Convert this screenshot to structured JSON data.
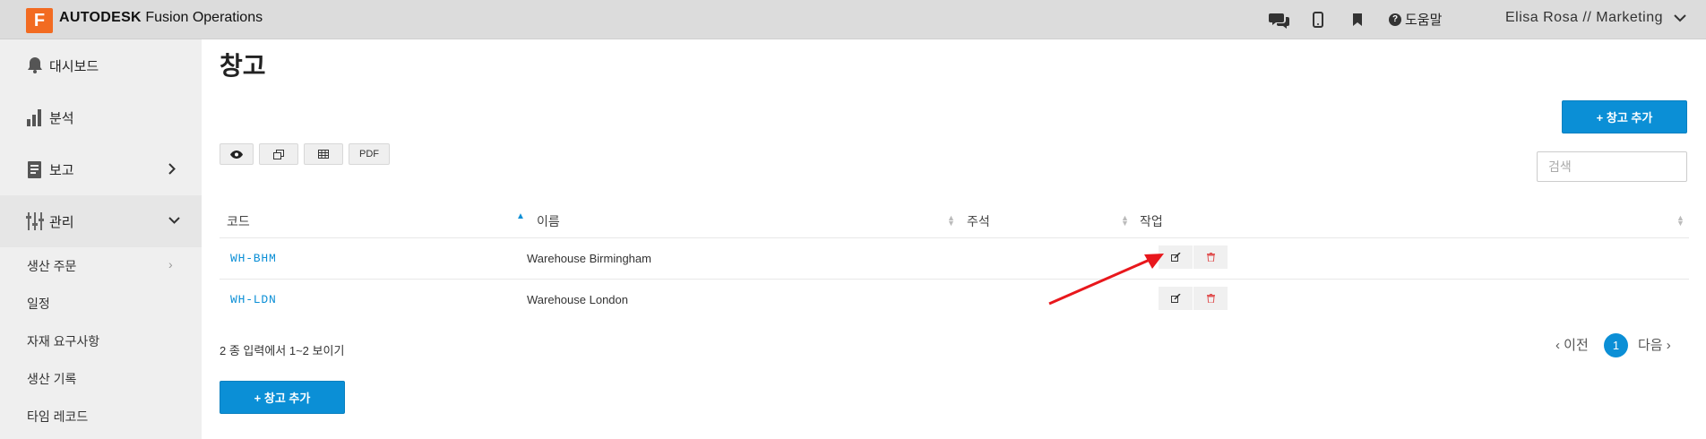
{
  "app": {
    "logo_letter": "F",
    "brand_bold": "AUTODESK",
    "brand_rest": "Fusion Operations",
    "help_label": "도움말",
    "user_label": "Elisa Rosa // Marketing",
    "accent": "#0b8fd6",
    "logo_color": "#f26b21"
  },
  "sidebar": {
    "items": [
      {
        "label": "대시보드",
        "icon": "bell-icon"
      },
      {
        "label": "분석",
        "icon": "bar-chart-icon"
      },
      {
        "label": "보고",
        "icon": "report-icon"
      },
      {
        "label": "관리",
        "icon": "sliders-icon"
      }
    ],
    "sub_items": [
      {
        "label": "생산 주문"
      },
      {
        "label": "일정"
      },
      {
        "label": "자재 요구사항"
      },
      {
        "label": "생산 기록"
      },
      {
        "label": "타임 레코드"
      }
    ]
  },
  "page": {
    "title": "창고",
    "add_button_top": "+ 창고 추가",
    "add_button_bottom": "+ 창고 추가",
    "toolbar": {
      "view": "eye-icon",
      "copy": "copy-icon",
      "csv": "table-icon",
      "pdf": "PDF"
    },
    "search_placeholder": "검색"
  },
  "table": {
    "columns": [
      "코드",
      "이름",
      "주석",
      "작업"
    ],
    "rows": [
      {
        "code": "WH-BHM",
        "name": "Warehouse Birmingham",
        "note": ""
      },
      {
        "code": "WH-LDN",
        "name": "Warehouse London",
        "note": ""
      }
    ],
    "summary": "2 종 입력에서 1~2 보이기"
  },
  "pagination": {
    "prev": "‹ 이전",
    "current": "1",
    "next": "다음 ›"
  }
}
